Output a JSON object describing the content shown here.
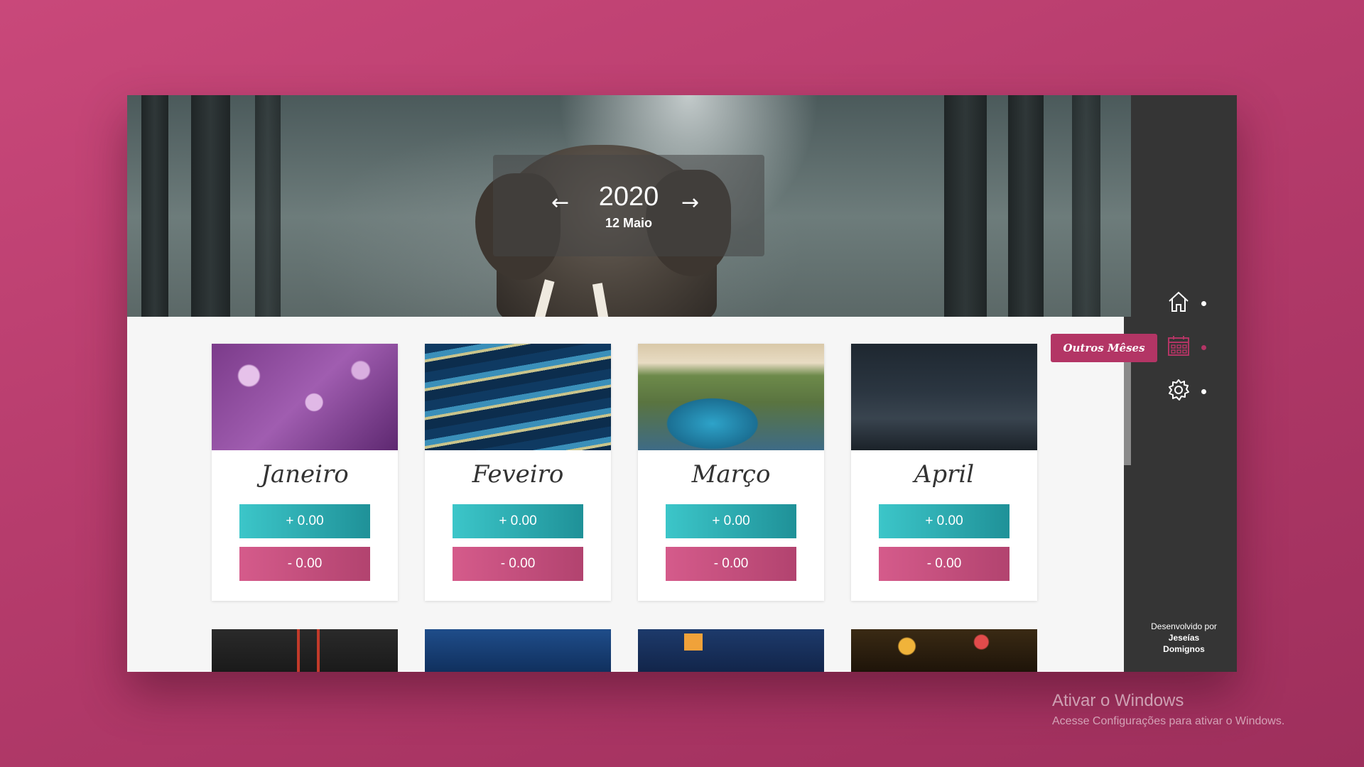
{
  "header": {
    "year": "2020",
    "date": "12 Maio",
    "prev_arrow": "←",
    "next_arrow": "→"
  },
  "months": [
    {
      "name": "Janeiro",
      "income": "+ 0.00",
      "expense": "- 0.00"
    },
    {
      "name": "Feveiro",
      "income": "+ 0.00",
      "expense": "- 0.00"
    },
    {
      "name": "Março",
      "income": "+ 0.00",
      "expense": "- 0.00"
    },
    {
      "name": "April",
      "income": "+ 0.00",
      "expense": "- 0.00"
    }
  ],
  "sidebar": {
    "tooltip": "Outros Mêses",
    "items": [
      {
        "icon": "home-icon"
      },
      {
        "icon": "calendar-icon",
        "active": true
      },
      {
        "icon": "gear-icon"
      }
    ],
    "credit_line1": "Desenvolvido por",
    "credit_line2": "Jeseías",
    "credit_line3": "Domignos"
  },
  "windows_notice": {
    "title": "Ativar o Windows",
    "subtitle": "Acesse Configurações para ativar o Windows."
  },
  "colors": {
    "accent": "#b33565",
    "teal": "#2aaeb3",
    "sidebar": "#353535"
  }
}
